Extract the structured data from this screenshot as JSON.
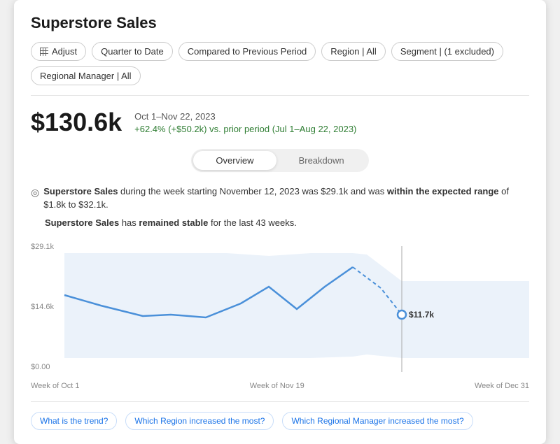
{
  "title": "Superstore Sales",
  "toolbar": {
    "adjust_label": "Adjust",
    "quarter_label": "Quarter to Date",
    "compared_label": "Compared to Previous Period",
    "region_label": "Region | All",
    "segment_label": "Segment | (1 excluded)",
    "manager_label": "Regional Manager | All"
  },
  "metric": {
    "value": "$130.6k",
    "period": "Oct 1–Nov 22, 2023",
    "change": "+62.4% (+$50.2k) vs. prior period (Jul 1–Aug 22, 2023)"
  },
  "tabs": {
    "overview_label": "Overview",
    "breakdown_label": "Breakdown",
    "active": "overview"
  },
  "insight": {
    "line1_prefix": "Superstore Sales",
    "line1_mid": " during the week starting November 12, 2023 was $29.1k and was ",
    "line1_bold": "within the expected range",
    "line1_suffix": " of $1.8k to $32.1k.",
    "line2_prefix": "Superstore Sales",
    "line2_mid": " has ",
    "line2_bold": "remained stable",
    "line2_suffix": " for the last 43 weeks."
  },
  "chart": {
    "y_labels": [
      "$29.1k",
      "$14.6k",
      "$0.00"
    ],
    "x_labels": [
      "Week of Oct 1",
      "Week of Nov 19",
      "Week of Dec 31"
    ],
    "data_label": "$11.7k"
  },
  "questions": [
    "What is the trend?",
    "Which Region increased the most?",
    "Which Regional Manager increased the most?"
  ]
}
